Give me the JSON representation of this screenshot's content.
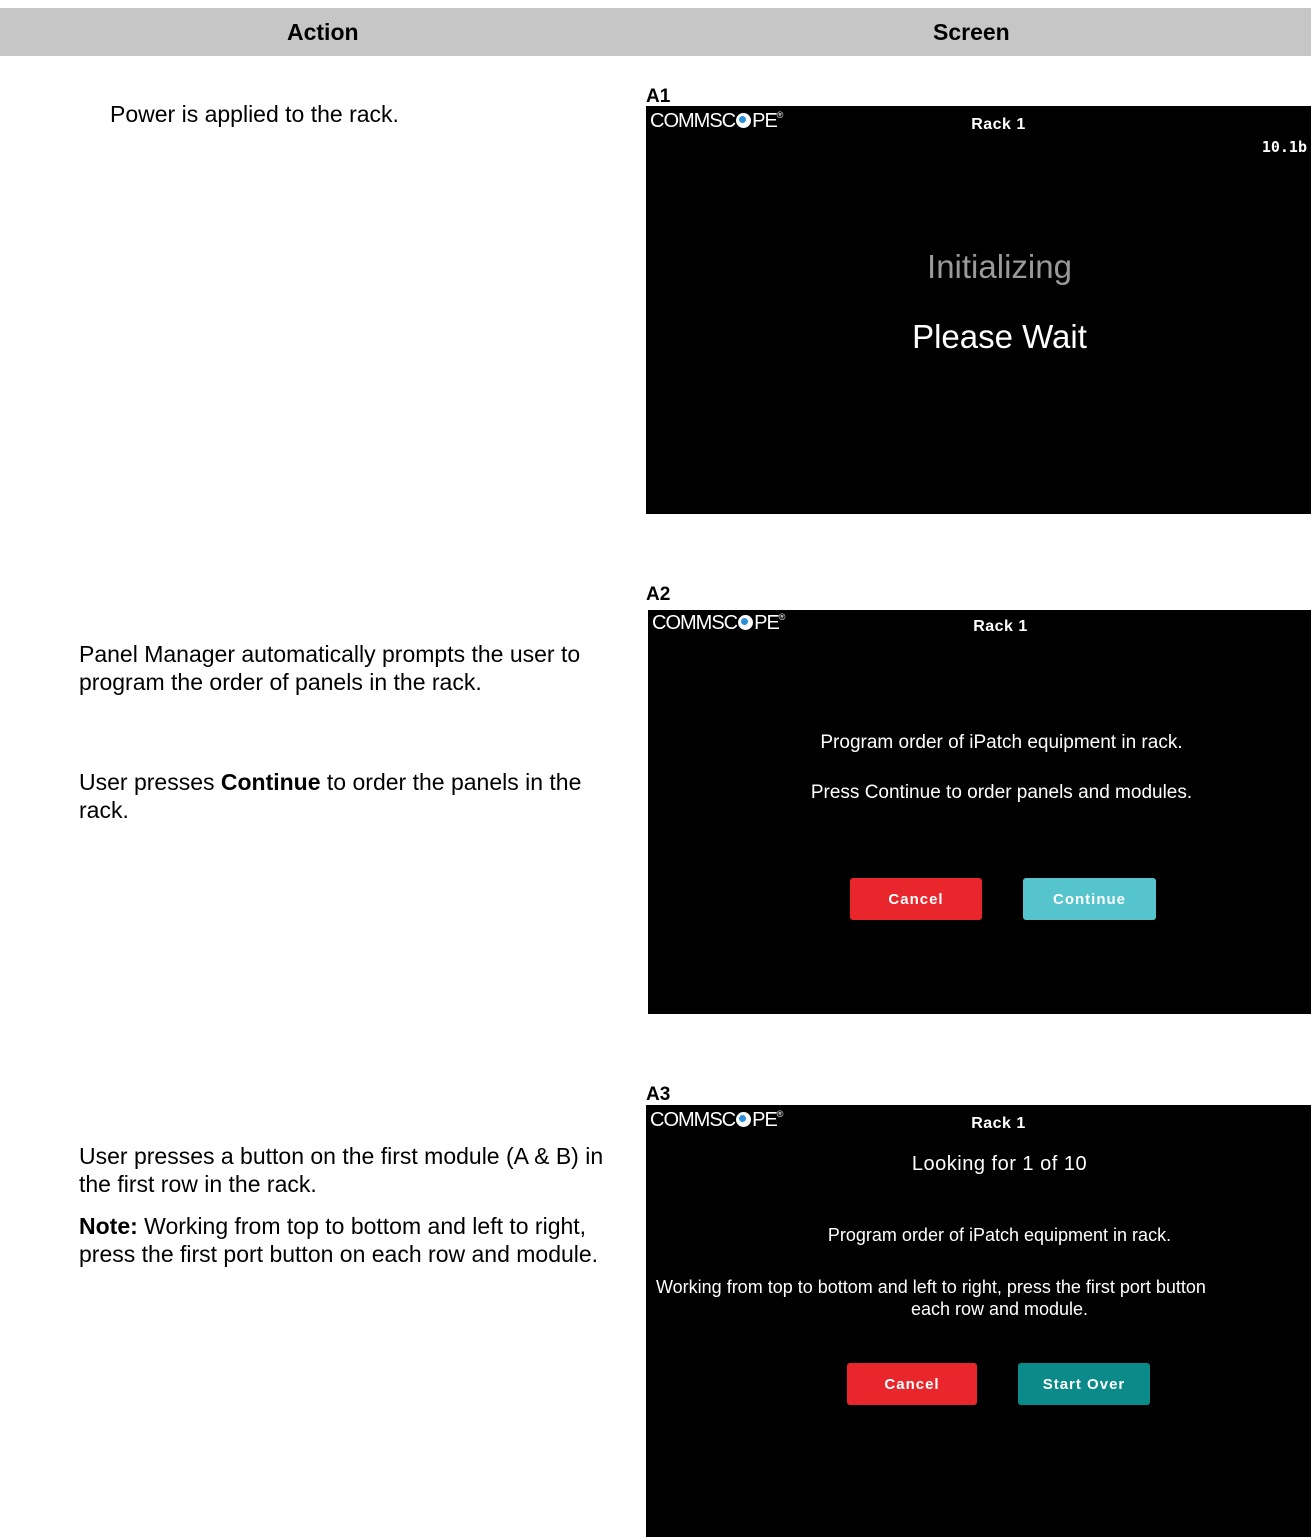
{
  "header": {
    "action": "Action",
    "screen": "Screen"
  },
  "steps": [
    {
      "label": "A1",
      "action": "Power is applied to the rack.",
      "screen": {
        "logo": "COMMSC",
        "logo_tail": "PE",
        "trademark": "®",
        "title": "Rack 1",
        "version": "10.1b",
        "line1": "Initializing",
        "line2": "Please Wait"
      }
    },
    {
      "label": "A2",
      "action_p1": "Panel Manager automatically prompts the user to program the order of panels in the rack.",
      "action_p2_before": "User presses ",
      "action_p2_bold": "Continue",
      "action_p2_after": " to order the panels in the rack.",
      "screen": {
        "logo": "COMMSC",
        "logo_tail": "PE",
        "trademark": "®",
        "title": "Rack 1",
        "line1": "Program order of iPatch equipment in rack.",
        "line2": "Press Continue to order panels and modules.",
        "cancel_label": "Cancel",
        "continue_label": "Continue"
      }
    },
    {
      "label": "A3",
      "action_p1": "User presses a button on the first module (A & B) in the first row in the rack.",
      "action_note_bold": "Note:",
      "action_note": "  Working from top to bottom and left to right, press the first port button on each row and module.",
      "screen": {
        "logo": "COMMSC",
        "logo_tail": "PE",
        "trademark": "®",
        "title": "Rack 1",
        "looking": "Looking for 1 of 10",
        "line1": "Program order of iPatch equipment in rack.",
        "line2a": "Working from top to bottom and left to right, press the first port button",
        "line2b": "each row and module.",
        "cancel_label": "Cancel",
        "start_over_label": "Start Over"
      }
    }
  ],
  "colors": {
    "cancel": "#e8262b",
    "continue": "#55c4cc",
    "start_over": "#0a8a88",
    "header_bg": "#c6c6c6"
  }
}
